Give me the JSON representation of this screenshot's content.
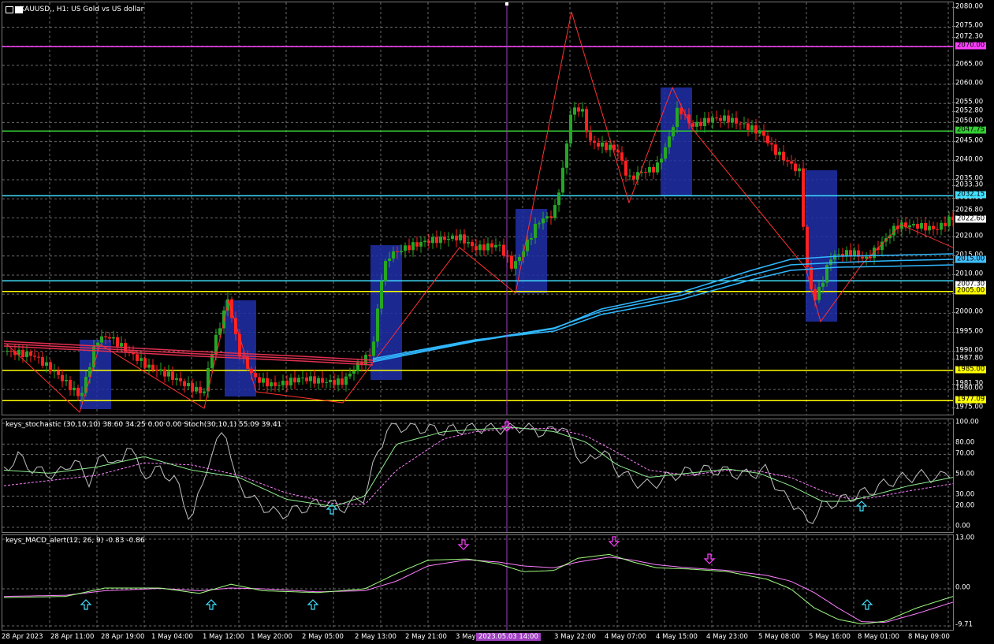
{
  "window": {
    "title": "XAUUSD,, H1:  US Gold vs US dollar",
    "icons": [
      "menu-icon",
      "chart-icon"
    ]
  },
  "price_axis": {
    "min": 1973.0,
    "max": 2081.5,
    "labels": [
      "2080.00",
      "2075.00",
      "2072.30",
      "2065.00",
      "2060.00",
      "2055.00",
      "2052.80",
      "2050.00",
      "2045.00",
      "2040.00",
      "2035.00",
      "2033.30",
      "2030.00",
      "2026.80",
      "2020.00",
      "2015.00",
      "2013.30",
      "2010.00",
      "2005.00",
      "2000.00",
      "1995.00",
      "1990.00",
      "1987.80",
      "1981.30",
      "1980.00",
      "1975.00"
    ],
    "tag_labels": [
      {
        "text": "2070.00",
        "value": 2069.9,
        "color": "#ff40ff"
      },
      {
        "text": "2047.75",
        "value": 2047.75,
        "color": "#33cc33"
      },
      {
        "text": "2032.15",
        "value": 2030.8,
        "color": "#40e0ff"
      },
      {
        "text": "2022.60",
        "value": 2024.4,
        "color": "#ffffff"
      },
      {
        "text": "2015.00",
        "value": 2014.0,
        "color": "#40c0ff"
      },
      {
        "text": "2007.30",
        "value": 2007.4,
        "color": "#ffffff"
      },
      {
        "text": "2005.00",
        "value": 2005.7,
        "color": "#ffff00"
      },
      {
        "text": "1985.00",
        "value": 1985.0,
        "color": "#ffff00"
      },
      {
        "text": "1977.09",
        "value": 1977.09,
        "color": "#ffff00"
      }
    ]
  },
  "levels": [
    {
      "value": 2069.9,
      "color": "#ff40ff"
    },
    {
      "value": 2047.75,
      "color": "#33cc33"
    },
    {
      "value": 2030.8,
      "color": "#40e0ff"
    },
    {
      "value": 2008.5,
      "color": "#40e0ff"
    },
    {
      "value": 2005.7,
      "color": "#ffff00"
    },
    {
      "value": 1985.0,
      "color": "#ffff00"
    },
    {
      "value": 1977.09,
      "color": "#ffff00"
    }
  ],
  "colors": {
    "bull": "#26a626",
    "bear": "#ff2020",
    "zigzag": "#ff3030",
    "box": "#1f2fa8",
    "ma_red": "#e03050",
    "ma_blue": "#30b8ff",
    "stoch_main": "#90ee90",
    "stoch_signal": "#ff80ff",
    "stoch_raw": "#c0c0c0",
    "macd_main": "#a0ff80",
    "macd_signal": "#ff80ff",
    "arrow_up": "#40e0ff",
    "arrow_down": "#ff40ff",
    "cursor": "#a040c0"
  },
  "stochastic": {
    "title": "keys_stochastic (30,10,10) 38.60 34.25 0.00 0.00 Stoch(30,10,1) 55.09 39.41",
    "axis_labels": [
      "100.00",
      "80.00",
      "70.00",
      "50.00",
      "30.00",
      "20.00",
      "0.00"
    ],
    "range": [
      0,
      100
    ]
  },
  "macd": {
    "title": "keys_MACD_alert(12, 26, 9) -0.83 -0.86",
    "axis_labels": [
      "13.00",
      "0.00",
      "-9.71"
    ],
    "range": [
      -9.71,
      13.0
    ]
  },
  "time_axis": {
    "labels": [
      "28 Apr 2023",
      "28 Apr 11:00",
      "28 Apr 19:00",
      "1 May 04:00",
      "1 May 12:00",
      "1 May 20:00",
      "2 May 05:00",
      "2 May 13:00",
      "2 May 21:00",
      "3 May 06:00",
      "3 May 22:00",
      "4 May 07:00",
      "4 May 15:00",
      "4 May 23:00",
      "5 May 08:00",
      "5 May 16:00",
      "8 May 01:00",
      "8 May 09:00"
    ],
    "cursor_label": "2023.05.03 14:00"
  }
}
